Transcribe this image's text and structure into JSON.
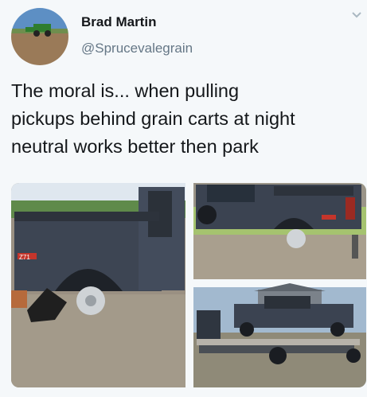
{
  "author": {
    "display_name": "Brad Martin",
    "handle": "@Sprucevalegrain"
  },
  "tweet": {
    "text_lines": [
      "The moral is... when pulling",
      "pickups behind grain carts at night",
      "neutral works better then park"
    ]
  },
  "media": {
    "badge_text": "Z71"
  },
  "icons": {
    "more": "chevron-down-icon"
  },
  "colors": {
    "name": "#14171a",
    "handle": "#657786",
    "background": "#f5f8fa",
    "truck": "#3a4250"
  }
}
